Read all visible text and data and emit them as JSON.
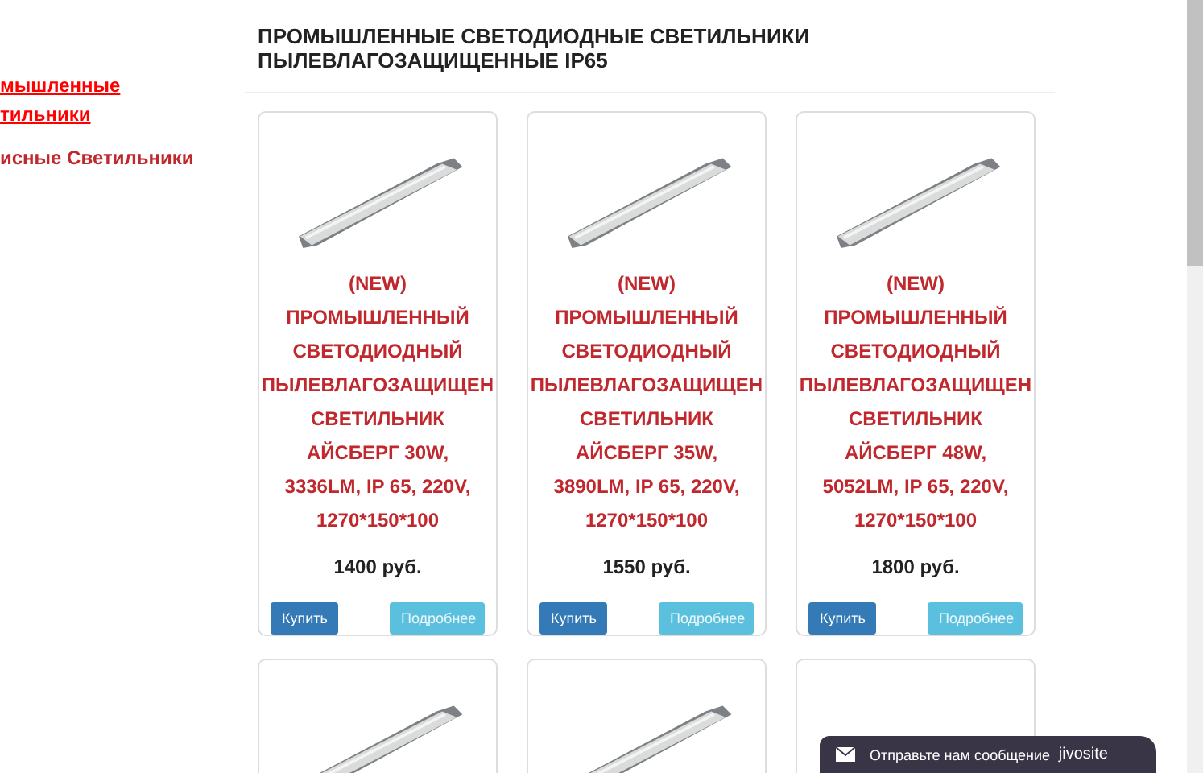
{
  "sidebar": {
    "items": [
      {
        "lines": [
          "мышленные",
          "тильники"
        ],
        "selected": true
      },
      {
        "lines": [
          "исные Светильники"
        ],
        "selected": false
      }
    ]
  },
  "heading": "ПРОМЫШЛЕННЫЕ СВЕТОДИОДНЫЕ СВЕТИЛЬНИКИ ПЫЛЕВЛАГОЗАЩИЩЕННЫЕ IP65",
  "products": [
    {
      "kind": "lamp",
      "title": [
        "(NEW)",
        "ПРОМЫШЛЕННЫЙ",
        "СВЕТОДИОДНЫЙ",
        "ПЫЛЕВЛАГОЗАЩИЩЕН",
        "СВЕТИЛЬНИК",
        "АЙСБЕРГ 30W,",
        "3336LM, IP 65, 220V,",
        "1270*150*100"
      ],
      "price": "1400 руб.",
      "buy": "Купить",
      "more": "Подробнее"
    },
    {
      "kind": "lamp",
      "title": [
        "(NEW)",
        "ПРОМЫШЛЕННЫЙ",
        "СВЕТОДИОДНЫЙ",
        "ПЫЛЕВЛАГОЗАЩИЩЕН",
        "СВЕТИЛЬНИК",
        "АЙСБЕРГ 35W,",
        "3890LM, IP 65, 220V,",
        "1270*150*100"
      ],
      "price": "1550 руб.",
      "buy": "Купить",
      "more": "Подробнее"
    },
    {
      "kind": "lamp",
      "title": [
        "(NEW)",
        "ПРОМЫШЛЕННЫЙ",
        "СВЕТОДИОДНЫЙ",
        "ПЫЛЕВЛАГОЗАЩИЩЕН",
        "СВЕТИЛЬНИК",
        "АЙСБЕРГ 48W,",
        "5052LM, IP 65, 220V,",
        "1270*150*100"
      ],
      "price": "1800 руб.",
      "buy": "Купить",
      "more": "Подробнее"
    },
    {
      "kind": "lamp"
    },
    {
      "kind": "lamp"
    },
    {
      "kind": "lamp-white"
    }
  ],
  "chat": {
    "label": "Отправьте нам сообщение",
    "brand": "jivosite"
  }
}
